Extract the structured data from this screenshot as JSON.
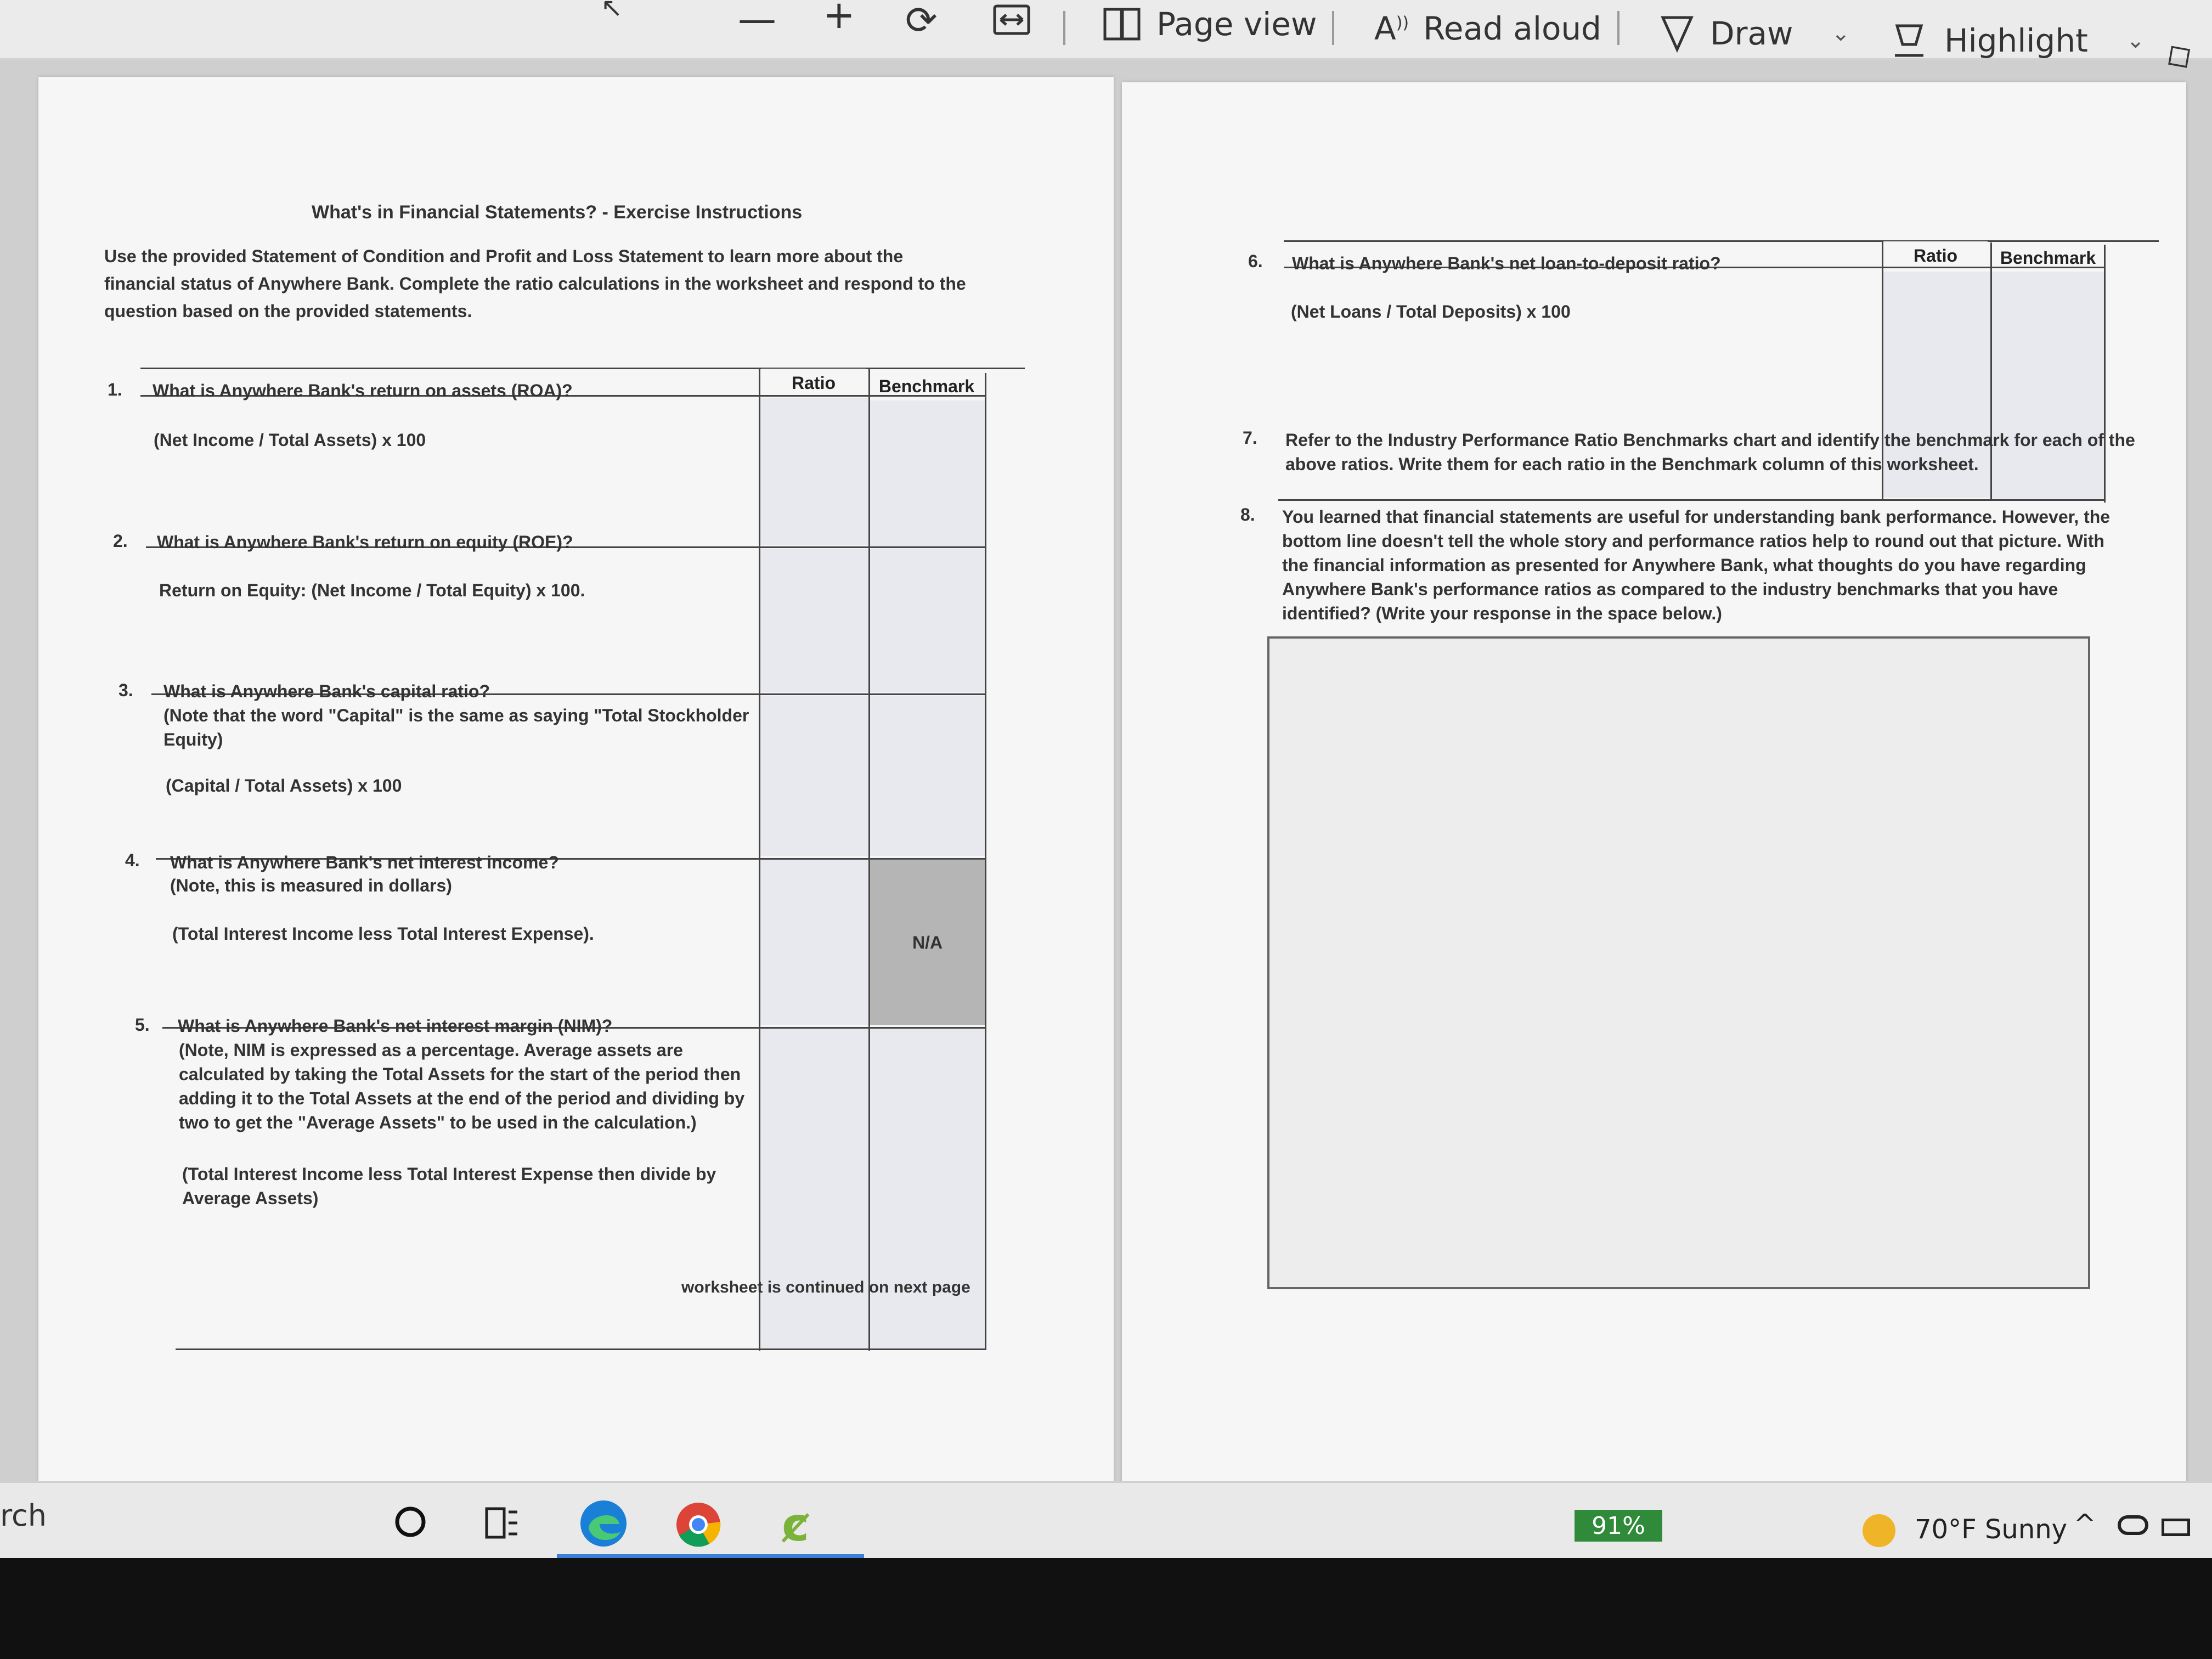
{
  "toolbar": {
    "minus_glyph": "—",
    "plus_glyph": "+",
    "page_view": "Page view",
    "read_aloud": "Read aloud",
    "read_aloud_icon": "A͡",
    "draw": "Draw",
    "highlight": "Highlight"
  },
  "left_page": {
    "title": "What's in Financial Statements? - Exercise Instructions",
    "intro": "Use the provided Statement of Condition and Profit and Loss Statement to learn more about the\nfinancial status of Anywhere Bank. Complete the ratio calculations in the worksheet and respond to the\nquestion based on the provided statements.",
    "col_ratio": "Ratio",
    "col_benchmark": "Benchmark",
    "questions": [
      {
        "num": "1.",
        "text": "What is Anywhere Bank's return on assets (ROA)?",
        "formula": "(Net Income / Total Assets) x 100"
      },
      {
        "num": "2.",
        "text": "What is Anywhere Bank's return on equity (ROE)?",
        "formula": "Return on Equity: (Net Income / Total Equity) x 100."
      },
      {
        "num": "3.",
        "text": "What is Anywhere Bank's capital ratio?",
        "note": "(Note that the word \"Capital\" is the same as saying \"Total Stockholder Equity)",
        "formula": "(Capital / Total Assets) x 100"
      },
      {
        "num": "4.",
        "text": "What is Anywhere Bank's net interest income?",
        "note": "(Note, this is measured in dollars)",
        "formula": "(Total Interest Income less Total Interest Expense).",
        "benchmark_value": "N/A"
      },
      {
        "num": "5.",
        "text": "What is Anywhere Bank's net interest margin (NIM)?",
        "note": "(Note, NIM is expressed as a percentage. Average assets are calculated by taking the Total Assets for the start of the period then adding it to the Total Assets at the end of the period and dividing by two to get the \"Average Assets\" to be used in the calculation.)",
        "formula": "(Total Interest Income less Total Interest Expense then divide by Average Assets)"
      }
    ],
    "continued": "worksheet is continued on next page"
  },
  "right_page": {
    "col_ratio": "Ratio",
    "col_benchmark": "Benchmark",
    "q6": {
      "num": "6.",
      "text": "What is Anywhere Bank's net loan-to-deposit ratio?",
      "formula": "(Net Loans / Total Deposits) x 100"
    },
    "q7": {
      "num": "7.",
      "text": "Refer to the Industry Performance Ratio Benchmarks chart and identify the benchmark for each of the above ratios. Write them for each ratio in the Benchmark column of this worksheet."
    },
    "q8": {
      "num": "8.",
      "text": "You learned that financial statements are useful for understanding bank performance. However, the bottom line doesn't tell the whole story and performance ratios help to round out that picture. With the financial information as presented for Anywhere Bank, what thoughts do you have regarding Anywhere Bank's performance ratios as compared to the industry benchmarks that you have identified? (Write your response in the space below.)"
    }
  },
  "taskbar": {
    "search_fragment": "rch",
    "battery": "91%",
    "weather": "70°F  Sunny"
  },
  "colors": {
    "cell_fill": "#e7e9ee",
    "na_fill": "#b5b5b5",
    "battery_green": "#2f8a3a"
  }
}
